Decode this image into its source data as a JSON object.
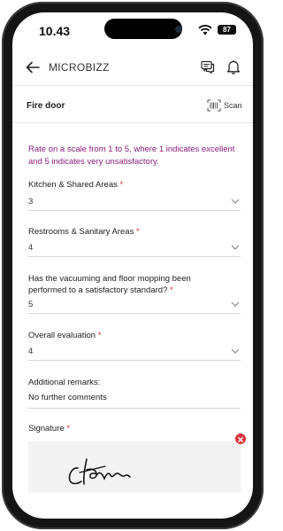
{
  "status_bar": {
    "time": "10.43",
    "battery": "87"
  },
  "app_bar": {
    "title": "MICROBIZZ"
  },
  "item": {
    "title": "Fire door",
    "scan_label": "Scan"
  },
  "form": {
    "hint": "Rate on a scale from 1 to 5, where 1 indicates excellent and 5 indicates very unsatisfactory.",
    "fields": [
      {
        "label": "Kitchen & Shared Areas",
        "required": "*",
        "value": "3"
      },
      {
        "label": "Restrooms & Sanitary Areas",
        "required": "*",
        "value": "4"
      },
      {
        "label": "Has the vacuuming and floor mopping been performed to a satisfactory standard?",
        "required": "*",
        "value": "5"
      },
      {
        "label": "Overall evaluation",
        "required": "*",
        "value": "4"
      }
    ],
    "remarks": {
      "label": "Additional remarks:",
      "value": "No further comments"
    },
    "signature": {
      "label": "Signature",
      "required": "*"
    }
  },
  "colors": {
    "hint": "#8a1d7b",
    "required": "#d62f2f",
    "phone_frame": "#151515"
  },
  "icons": [
    "back-arrow-icon",
    "chat-icon",
    "bell-icon",
    "barcode-scan-icon",
    "chevron-down-icon",
    "delete-icon",
    "wifi-icon"
  ]
}
